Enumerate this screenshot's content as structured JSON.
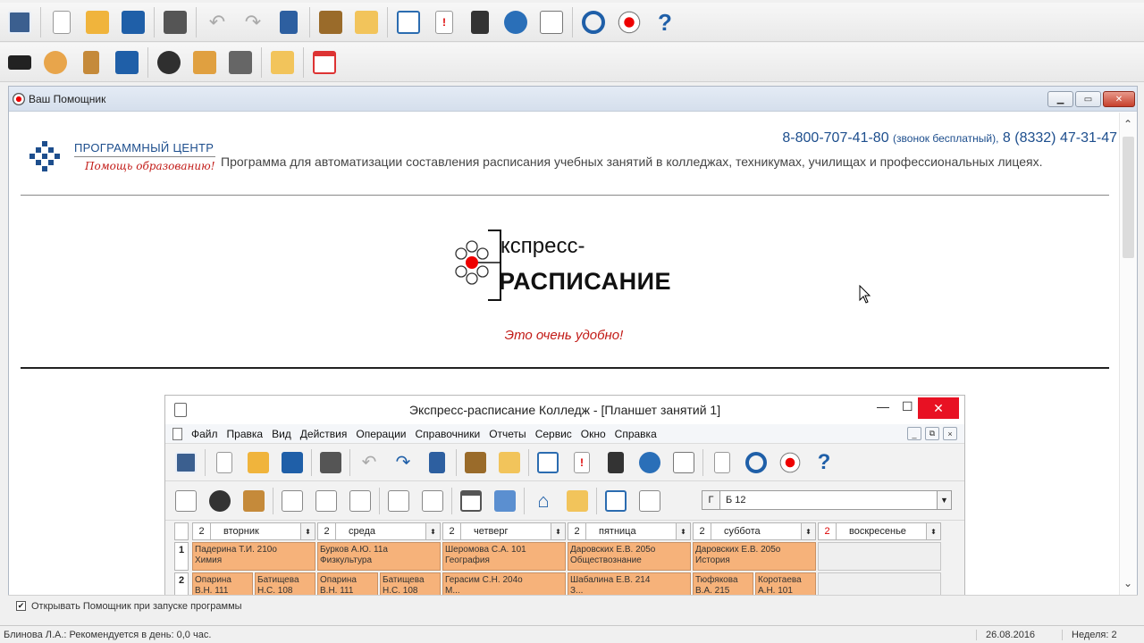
{
  "toolbar_main": {
    "icons": [
      "schedule-list-icon",
      "new-doc-icon",
      "open-folder-icon",
      "save-icon",
      "print-icon",
      "undo-icon",
      "redo-icon",
      "edit-icon",
      "printer-alt-icon",
      "folders-icon",
      "book-icon",
      "alert-doc-icon",
      "calculator-icon",
      "globe-icon",
      "window-arrow-icon",
      "refresh-icon",
      "flower-logo-icon",
      "help-icon"
    ]
  },
  "toolbar_second": {
    "icons": [
      "graduation-cap-icon",
      "teachers-icon",
      "door-icon",
      "rooms-icon",
      "students-icon",
      "settings-people-icon",
      "computers-icon",
      "documents-icon",
      "calendar-icon"
    ]
  },
  "assistant": {
    "title": "Ваш Помощник",
    "company_name": "ПРОГРАММНЫЙ ЦЕНТР",
    "company_slogan": "Помощь образованию!",
    "phone_main": "8-800-707-41-80",
    "phone_note": "(звонок бесплатный),",
    "phone_alt": "8 (8332) 47-31-47",
    "description": "Программа для автоматизации составления расписания учебных занятий в колледжах, техникумах, училищах и профессиональных лицеях.",
    "product_line1": "кспресс-",
    "product_line2": "РАСПИСАНИЕ",
    "tagline": "Это очень удобно!",
    "option_label": "Открывать Помощник при запуске программы",
    "option_checked": "✔"
  },
  "screenshot": {
    "title": "Экспресс-расписание Колледж - [Планшет занятий 1]",
    "min": "—",
    "max": "☐",
    "close": "✕",
    "menu": [
      "Файл",
      "Правка",
      "Вид",
      "Действия",
      "Операции",
      "Справочники",
      "Отчеты",
      "Сервис",
      "Окно",
      "Справка"
    ],
    "mini_ctl": [
      "_",
      "⧉",
      "×"
    ],
    "group_label": "Г",
    "group_value": "Б 12",
    "group_dropdown": "▼",
    "days": [
      {
        "num": "2",
        "label": "вторник"
      },
      {
        "num": "2",
        "label": "среда"
      },
      {
        "num": "2",
        "label": "четверг"
      },
      {
        "num": "2",
        "label": "пятница"
      },
      {
        "num": "2",
        "label": "суббота"
      },
      {
        "num": "2",
        "label": "воскресенье"
      }
    ],
    "row1": {
      "num": "1",
      "cells": [
        {
          "l1": "Падерина Т.И.   210о",
          "l2": "Химия"
        },
        {
          "l1": "Бурков А.Ю.   11а",
          "l2": "Физкультура"
        },
        {
          "l1": "Шеромова С.А.   101",
          "l2": "География"
        },
        {
          "l1": "Даровских Е.В.   205о",
          "l2": "Обществознание"
        },
        {
          "l1": "Даровских Е.В.   205о",
          "l2": "История"
        }
      ]
    },
    "row2": {
      "num": "2",
      "cells": [
        {
          "l1": "Опарина",
          "l2": "В.Н.   111"
        },
        {
          "l1": "Батищева",
          "l2": "Н.С.   108"
        },
        {
          "l1": "Опарина",
          "l2": "В.Н.   111"
        },
        {
          "l1": "Батищева",
          "l2": "Н.С.   108"
        },
        {
          "l1": "Герасим С.Н.   204о",
          "l2": "М..."
        },
        {
          "l1": "Шабалина Е.В.   214",
          "l2": "З..."
        },
        {
          "l1": "Тюфякова",
          "l2": "В.А.   215"
        },
        {
          "l1": "Коротаева",
          "l2": "А.Н.   101"
        }
      ]
    }
  },
  "status": {
    "user": "Блинова Л.А.: Рекомендуется в день: 0,0 час.",
    "date": "26.08.2016",
    "week": "Неделя: 2"
  }
}
